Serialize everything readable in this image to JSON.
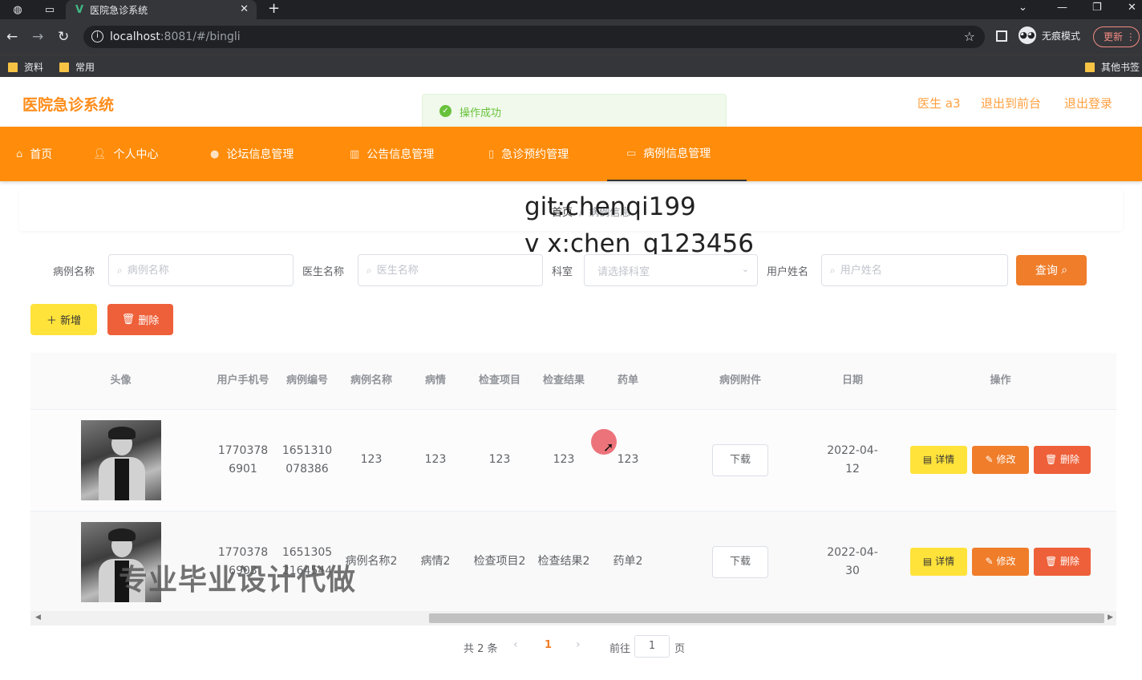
{
  "browser": {
    "tab_title": "医院急诊系统",
    "url_host": "localhost",
    "url_rest": ":8081/#/bingli",
    "incognito_label": "无痕模式",
    "update_label": "更新",
    "bookmarks": [
      "资料",
      "常用",
      "其他书签"
    ]
  },
  "header": {
    "app_title": "医院急诊系统",
    "user_label": "医生 a3",
    "front_label": "退出到前台",
    "logout_label": "退出登录"
  },
  "toast": {
    "message": "操作成功"
  },
  "nav": {
    "items": [
      {
        "label": "首页",
        "icon": "home-icon"
      },
      {
        "label": "个人中心",
        "icon": "user-icon"
      },
      {
        "label": "论坛信息管理",
        "icon": "forum-icon"
      },
      {
        "label": "公告信息管理",
        "icon": "notice-icon"
      },
      {
        "label": "急诊预约管理",
        "icon": "calendar-icon"
      },
      {
        "label": "病例信息管理",
        "icon": "record-icon"
      }
    ],
    "active": "病例信息管理"
  },
  "breadcrumb": {
    "home": "首页",
    "current": "病例信息"
  },
  "watermarks": {
    "line1": "git:chenqi199",
    "line2": "v x:chen_q123456",
    "line3": "专业毕业设计代做"
  },
  "search": {
    "fields": [
      {
        "label": "病例名称",
        "placeholder": "病例名称"
      },
      {
        "label": "医生名称",
        "placeholder": "医生名称"
      },
      {
        "label": "科室",
        "placeholder": "请选择科室"
      },
      {
        "label": "用户姓名",
        "placeholder": "用户姓名"
      }
    ],
    "query_label": "查询"
  },
  "actions": {
    "add_label": "新增",
    "delete_label": "删除"
  },
  "table": {
    "headers": [
      "头像",
      "用户手机号",
      "病例编号",
      "病例名称",
      "病情",
      "检查项目",
      "检查结果",
      "药单",
      "病例附件",
      "日期",
      "操作"
    ],
    "rows": [
      {
        "phone": "17703786901",
        "code": "1651310078386",
        "name": "123",
        "condition": "123",
        "item": "123",
        "result": "123",
        "prescription": "123",
        "attachment": "下载",
        "date": "2022-04-12"
      },
      {
        "phone": "17703786903",
        "code": "16513052164544",
        "name": "病例名称2",
        "condition": "病情2",
        "item": "检查项目2",
        "result": "检查结果2",
        "prescription": "药单2",
        "attachment": "下载",
        "date": "2022-04-30"
      }
    ],
    "ops": {
      "detail": "详情",
      "edit": "修改",
      "remove": "删除"
    }
  },
  "pagination": {
    "total_text": "共 2 条",
    "current_page": "1",
    "goto_label": "前往",
    "goto_value": "1",
    "page_suffix": "页"
  },
  "colors": {
    "nav_bg": "#ff8c0a",
    "accent": "#f07d2a",
    "yellow_btn": "#ffe33b",
    "danger_btn": "#ee6039",
    "title": "#ff8c1a"
  }
}
